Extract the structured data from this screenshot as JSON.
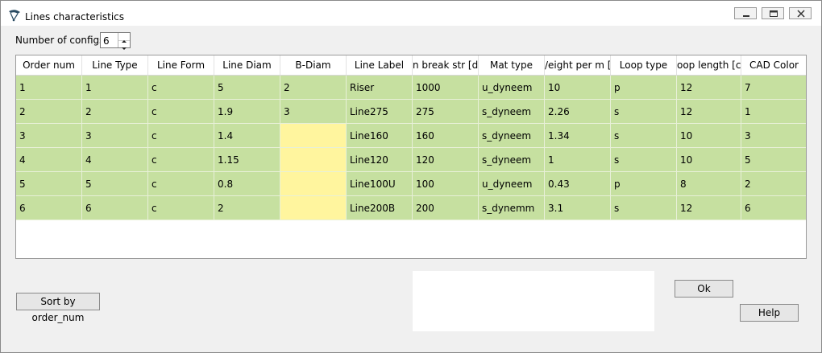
{
  "window": {
    "title": "Lines characteristics",
    "icon": "paraglider-icon"
  },
  "configs": {
    "label": "Number of configs",
    "value": "6"
  },
  "table": {
    "columns": [
      "Order num",
      "Line Type",
      "Line Form",
      "Line Diam",
      "B-Diam",
      "Line Label",
      "n break str [da",
      "Mat type",
      "/eight per m [g",
      "Loop type",
      "oop length [cn",
      "CAD Color"
    ],
    "rows": [
      [
        "1",
        "1",
        "c",
        "5",
        "2",
        "Riser",
        "1000",
        "u_dyneem",
        "10",
        "p",
        "12",
        "7"
      ],
      [
        "2",
        "2",
        "c",
        "1.9",
        "3",
        "Line275",
        "275",
        "s_dyneem",
        "2.26",
        "s",
        "12",
        "1"
      ],
      [
        "3",
        "3",
        "c",
        "1.4",
        "",
        "Line160",
        "160",
        "s_dyneem",
        "1.34",
        "s",
        "10",
        "3"
      ],
      [
        "4",
        "4",
        "c",
        "1.15",
        "",
        "Line120",
        "120",
        "s_dyneem",
        "1",
        "s",
        "10",
        "5"
      ],
      [
        "5",
        "5",
        "c",
        "0.8",
        "",
        "Line100U",
        "100",
        "u_dyneem",
        "0.43",
        "p",
        "8",
        "2"
      ],
      [
        "6",
        "6",
        "c",
        "2",
        "",
        "Line200B",
        "200",
        "s_dynemm",
        "3.1",
        "s",
        "12",
        "6"
      ]
    ]
  },
  "buttons": {
    "sort": "Sort by order_num",
    "ok": "Ok",
    "help": "Help"
  },
  "colors": {
    "row_fill": "#c6e0a0",
    "empty_bdiam": "#fff59e"
  }
}
